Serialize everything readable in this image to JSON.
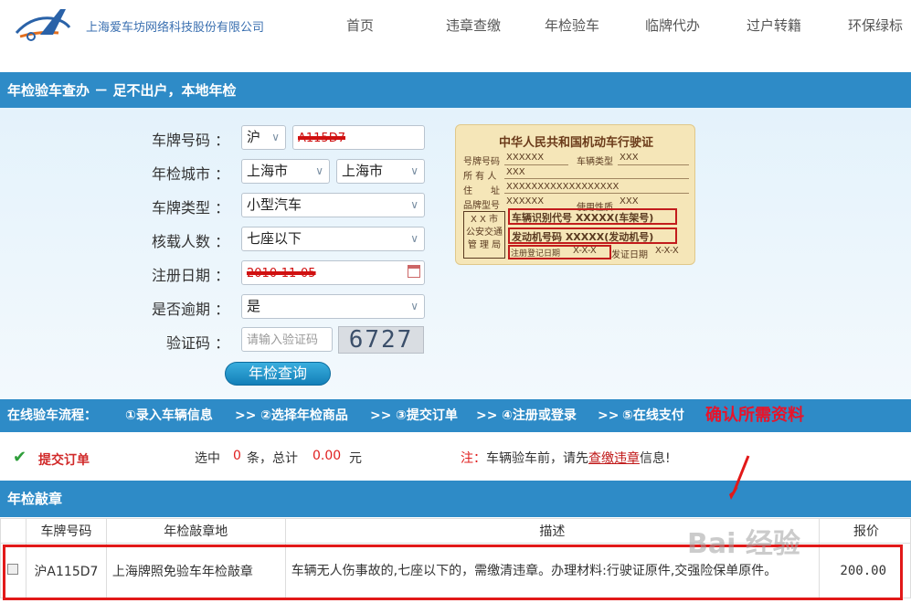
{
  "header": {
    "brand": "上海爱车坊网络科技股份有限公司",
    "nav": [
      "首页",
      "违章查缴",
      "年检验车",
      "临牌代办",
      "过户转籍",
      "环保绿标"
    ]
  },
  "banner": {
    "title": "年检验车查办 － 足不出户，本地年检"
  },
  "form": {
    "plate_label": "车牌号码 ：",
    "plate_prefix": "沪",
    "plate_value": "A115D7",
    "city_label": "年检城市 ：",
    "city_province": "上海市",
    "city_city": "上海市",
    "type_label": "车牌类型 ：",
    "type_value": "小型汽车",
    "seats_label": "核载人数 ：",
    "seats_value": "七座以下",
    "date_label": "注册日期 ：",
    "date_value": "2010-11-05",
    "overdue_label": "是否逾期 ：",
    "overdue_value": "是",
    "captcha_label": "验证码 ：",
    "captcha_placeholder": "请输入验证码",
    "captcha_code": "6727",
    "submit_label": "年检查询"
  },
  "license_card": {
    "title": "中华人民共和国机动车行驶证",
    "plate_label": "号牌号码",
    "plate_value": "XXXXXX",
    "vtype_label": "车辆类型",
    "vtype_value": "XXX",
    "owner_label": "所 有 人",
    "owner_value": "XXX",
    "addr_label": "住　　址",
    "addr_value": "XXXXXXXXXXXXXXXXXX",
    "model_label": "品牌型号",
    "model_value": "XXXXXX",
    "use_label": "使用性质",
    "use_value": "XXX",
    "stamp": "X X 市\n公安交通\n管 理 局",
    "vin": "车辆识别代号 XXXXX(车架号)",
    "engine": "发动机号码 XXXXX(发动机号)",
    "reg_label": "注册登记日期",
    "reg_value": "X-X-X",
    "issue_label": "发证日期",
    "issue_value": "X-X-X"
  },
  "process": {
    "label": "在线验车流程：",
    "steps": [
      "①录入车辆信息",
      ">>",
      "②选择年检商品",
      ">>",
      "③提交订单",
      ">>",
      "④注册或登录",
      ">>",
      "⑤在线支付"
    ],
    "highlight": "确认所需资料"
  },
  "summary": {
    "submit": "提交订单",
    "selected_prefix": "选中",
    "selected_count": "0",
    "selected_mid": "条，总计",
    "total": "0.00",
    "currency": "元",
    "note_label": "注：",
    "note_text": "车辆验车前，请先",
    "note_link": "查缴违章",
    "note_suffix": "信息!"
  },
  "section2": {
    "title": "年检敲章"
  },
  "table": {
    "headers": [
      "车牌号码",
      "年检敲章地",
      "描述",
      "报价"
    ],
    "rows": [
      {
        "plate": "沪A115D7",
        "place": "上海牌照免验车年检敲章",
        "desc": "车辆无人伤事故的,七座以下的，需缴清违章。办理材料:行驶证原件,交强险保单原件。",
        "price": "200.00"
      }
    ]
  },
  "watermark": "Bai 经验",
  "colors": {
    "bar": "#2e8bc7",
    "accent_red": "#e21919",
    "brand_blue": "#3a6fb0"
  }
}
